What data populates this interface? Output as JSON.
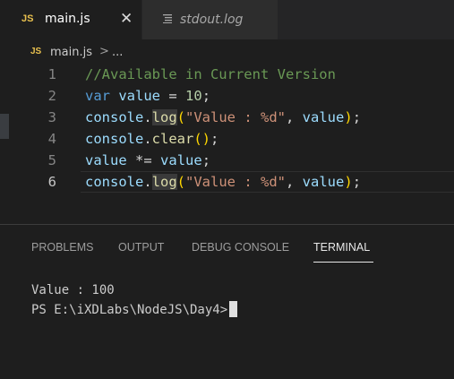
{
  "tabs": [
    {
      "icon": "js-file-icon",
      "badge": "JS",
      "label": "main.js",
      "active": true
    },
    {
      "icon": "text-file-icon",
      "label": "stdout.log",
      "active": false
    }
  ],
  "breadcrumb": {
    "badge": "JS",
    "file": "main.js",
    "separator": ">",
    "more": "..."
  },
  "editor": {
    "current_line": 6,
    "line_numbers": [
      "1",
      "2",
      "3",
      "4",
      "5",
      "6"
    ]
  },
  "panel": {
    "tabs": [
      "PROBLEMS",
      "OUTPUT",
      "DEBUG CONSOLE",
      "TERMINAL"
    ],
    "active_tab": "TERMINAL",
    "terminal_lines": [
      "Value : 100",
      "PS E:\\iXDLabs\\NodeJS\\Day4>"
    ]
  },
  "colors": {
    "background": "#1e1e1e",
    "tab_bar": "#252526",
    "js_badge": "#e8c04e",
    "keyword": "#569cd6",
    "variable": "#9cdcfe",
    "function": "#dcdcaa",
    "string": "#ce9178",
    "number": "#b5cea8",
    "comment": "#6a9955"
  }
}
